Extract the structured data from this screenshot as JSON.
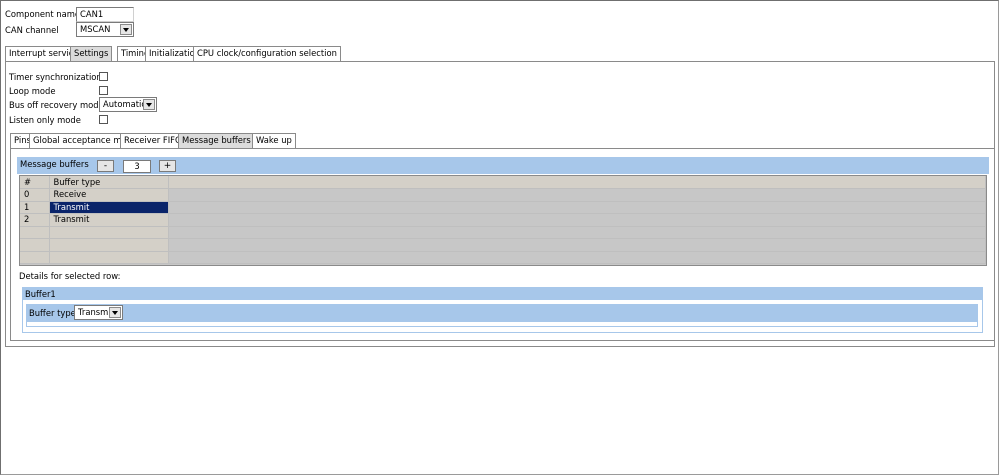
{
  "component": {
    "name_label": "Component name",
    "name_value": "CAN1",
    "channel_label": "CAN channel",
    "channel_value": "MSCAN"
  },
  "main_tabs": [
    {
      "label": "Interrupt service"
    },
    {
      "label": "Settings"
    },
    {
      "label": "Timing"
    },
    {
      "label": "Initialization"
    },
    {
      "label": "CPU clock/configuration selection"
    }
  ],
  "settings": {
    "timer_sync_label": "Timer synchronization",
    "timer_sync_checked": false,
    "loop_mode_label": "Loop mode",
    "loop_mode_checked": false,
    "bus_off_label": "Bus off recovery mode",
    "bus_off_value": "Automatic",
    "listen_only_label": "Listen only mode",
    "listen_only_checked": false
  },
  "sub_tabs": [
    {
      "label": "Pins"
    },
    {
      "label": "Global acceptance mask"
    },
    {
      "label": "Receiver FIFO"
    },
    {
      "label": "Message buffers"
    },
    {
      "label": "Wake up"
    }
  ],
  "message_buffers": {
    "title": "Message buffers",
    "minus_label": "-",
    "count": "3",
    "plus_label": "+",
    "columns": [
      "#",
      "Buffer type"
    ],
    "rows": [
      {
        "index": "0",
        "type": "Receive"
      },
      {
        "index": "1",
        "type": "Transmit"
      },
      {
        "index": "2",
        "type": "Transmit"
      }
    ],
    "selected_row": 1,
    "details_label": "Details for selected row:",
    "detail_group_title": "Buffer1",
    "buffer_type_label": "Buffer type",
    "buffer_type_value": "Transmit"
  }
}
